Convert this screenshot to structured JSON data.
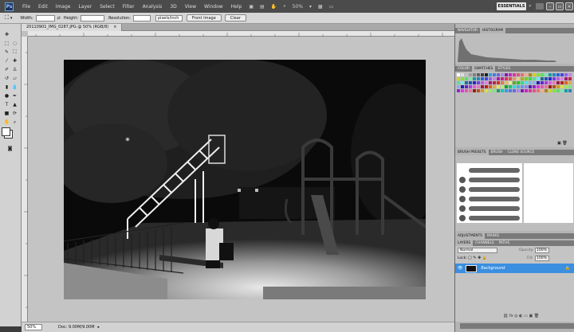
{
  "menubar": {
    "app_logo": "Ps",
    "items": [
      "File",
      "Edit",
      "Image",
      "Layer",
      "Select",
      "Filter",
      "Analysis",
      "3D",
      "View",
      "Window",
      "Help"
    ],
    "zoom_level": "50%",
    "workspace": "ESSENTIALS",
    "separator": "»"
  },
  "options_bar": {
    "width_label": "Width:",
    "height_label": "Height:",
    "resolution_label": "Resolution:",
    "resolution_unit": "pixels/inch",
    "front_image": "Front Image",
    "clear": "Clear"
  },
  "document": {
    "tab_title": "20110901_IMG_0287.JPG @ 50% (RGB/8)",
    "tab_close": "×"
  },
  "status": {
    "zoom": "50%",
    "doc_info": "Doc: 9.00M/9.00M"
  },
  "panels": {
    "navigator_tabs": [
      "NAVIGATOR",
      "HISTOGRAM"
    ],
    "color_tabs": [
      "COLOR",
      "SWATCHES",
      "STYLES"
    ],
    "brush_tabs": [
      "BRUSH PRESETS",
      "BRUSH",
      "CLONE SOURCE"
    ],
    "adjust_tabs": [
      "ADJUSTMENTS",
      "MASKS"
    ],
    "layers_tabs": [
      "LAYERS",
      "CHANNELS",
      "PATHS"
    ],
    "blend_mode": "Normal",
    "opacity_label": "Opacity:",
    "opacity_value": "100%",
    "lock_label": "Lock:",
    "fill_label": "Fill:",
    "fill_value": "100%",
    "layer_name": "Background",
    "history_tab": "HISTORY"
  },
  "colors": {
    "menubar": "#4b4b4b",
    "layer_selected": "#3b8fe0",
    "canvas_bg": "#c4c4c4"
  }
}
